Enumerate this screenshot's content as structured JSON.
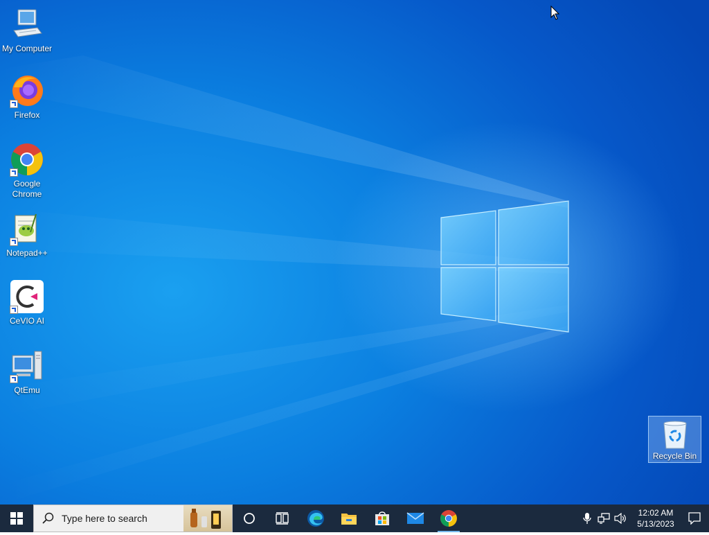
{
  "desktop": {
    "icons": [
      {
        "label": "My Computer",
        "icon": "computer-icon"
      },
      {
        "label": "Firefox",
        "icon": "firefox-icon"
      },
      {
        "label": "Google Chrome",
        "icon": "chrome-icon"
      },
      {
        "label": "Notepad++",
        "icon": "notepadpp-icon"
      },
      {
        "label": "CeVIO AI",
        "icon": "cevio-icon"
      },
      {
        "label": "QtEmu",
        "icon": "qtemu-icon"
      }
    ],
    "recycle_bin": {
      "label": "Recycle Bin",
      "icon": "recycle-bin-icon"
    }
  },
  "taskbar": {
    "search_placeholder": "Type here to search",
    "pinned": [
      {
        "name": "cortana-icon"
      },
      {
        "name": "task-view-icon"
      },
      {
        "name": "edge-icon"
      },
      {
        "name": "file-explorer-icon"
      },
      {
        "name": "store-icon"
      },
      {
        "name": "mail-icon"
      },
      {
        "name": "chrome-icon"
      }
    ],
    "clock": {
      "time": "12:02 AM",
      "date": "5/13/2023"
    }
  },
  "colors": {
    "taskbar_bg": "#1b2a3e",
    "desktop_blue": "#0b7fe0",
    "accent": "#76b9ed"
  }
}
